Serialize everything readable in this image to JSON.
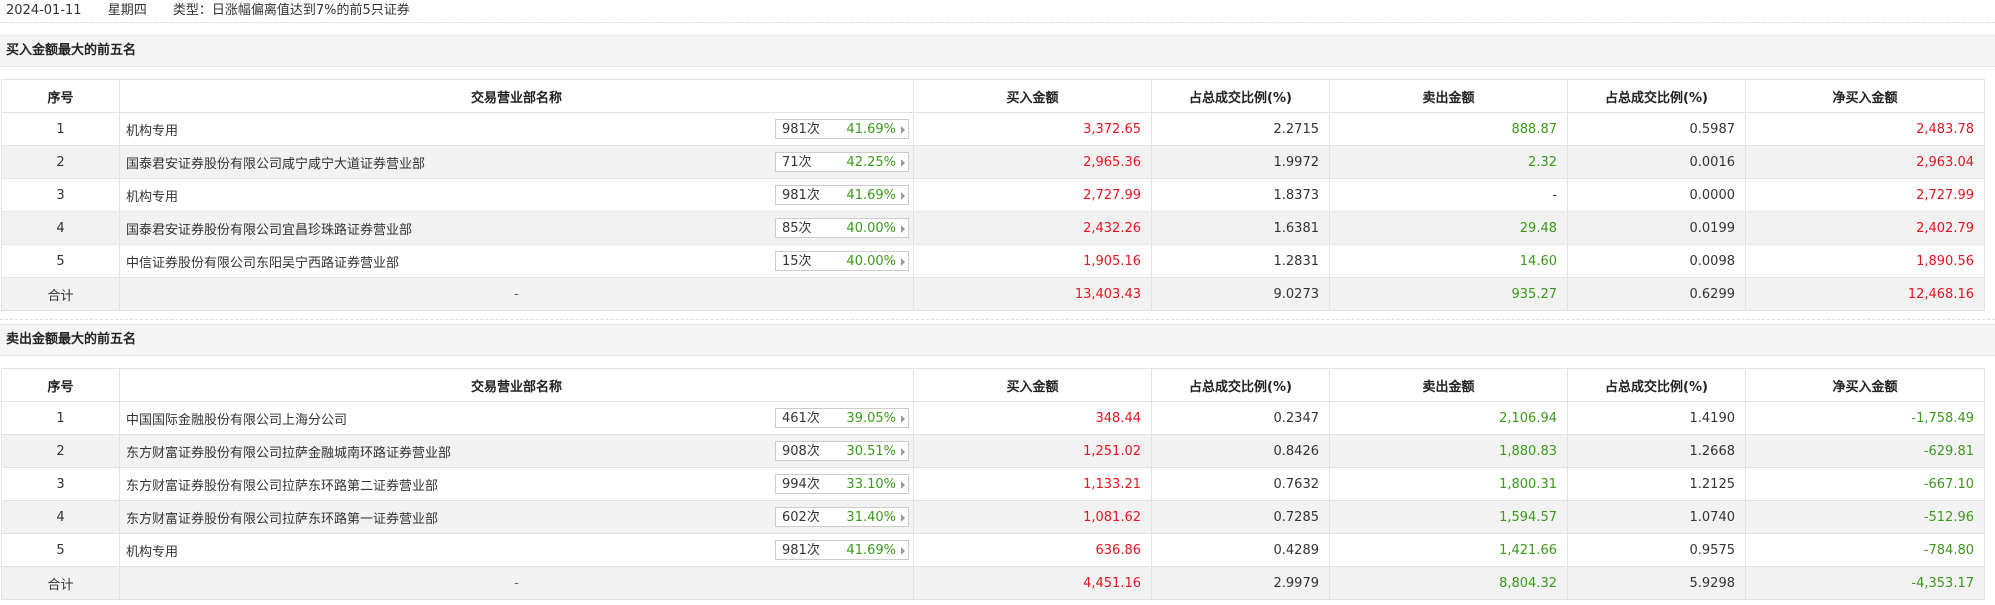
{
  "header": {
    "date": "2024-01-11",
    "weekday": "星期四",
    "type_text": "类型：日涨幅偏离值达到7%的前5只证券"
  },
  "columns": [
    "序号",
    "交易营业部名称",
    "买入金额",
    "占总成交比例(%)",
    "卖出金额",
    "占总成交比例(%)",
    "净买入金额"
  ],
  "colors": {
    "positive": "#e8141f",
    "negative": "#3a9a19",
    "badge_pct": "#3a9a19"
  },
  "buy_section": {
    "title": "买入金额最大的前五名",
    "rows": [
      {
        "idx": "1",
        "name": "机构专用",
        "count": "981次",
        "pct": "41.69%",
        "buy": "3,372.65",
        "buy_ratio": "2.2715",
        "sell": "888.87",
        "sell_ratio": "0.5987",
        "net": "2,483.78"
      },
      {
        "idx": "2",
        "name": "国泰君安证券股份有限公司咸宁咸宁大道证券营业部",
        "count": "71次",
        "pct": "42.25%",
        "buy": "2,965.36",
        "buy_ratio": "1.9972",
        "sell": "2.32",
        "sell_ratio": "0.0016",
        "net": "2,963.04"
      },
      {
        "idx": "3",
        "name": "机构专用",
        "count": "981次",
        "pct": "41.69%",
        "buy": "2,727.99",
        "buy_ratio": "1.8373",
        "sell": "-",
        "sell_ratio": "0.0000",
        "net": "2,727.99"
      },
      {
        "idx": "4",
        "name": "国泰君安证券股份有限公司宜昌珍珠路证券营业部",
        "count": "85次",
        "pct": "40.00%",
        "buy": "2,432.26",
        "buy_ratio": "1.6381",
        "sell": "29.48",
        "sell_ratio": "0.0199",
        "net": "2,402.79"
      },
      {
        "idx": "5",
        "name": "中信证券股份有限公司东阳吴宁西路证券营业部",
        "count": "15次",
        "pct": "40.00%",
        "buy": "1,905.16",
        "buy_ratio": "1.2831",
        "sell": "14.60",
        "sell_ratio": "0.0098",
        "net": "1,890.56"
      }
    ],
    "total": {
      "label": "合计",
      "name": "-",
      "buy": "13,403.43",
      "buy_ratio": "9.0273",
      "sell": "935.27",
      "sell_ratio": "0.6299",
      "net": "12,468.16"
    }
  },
  "sell_section": {
    "title": "卖出金额最大的前五名",
    "rows": [
      {
        "idx": "1",
        "name": "中国国际金融股份有限公司上海分公司",
        "count": "461次",
        "pct": "39.05%",
        "buy": "348.44",
        "buy_ratio": "0.2347",
        "sell": "2,106.94",
        "sell_ratio": "1.4190",
        "net": "-1,758.49"
      },
      {
        "idx": "2",
        "name": "东方财富证券股份有限公司拉萨金融城南环路证券营业部",
        "count": "908次",
        "pct": "30.51%",
        "buy": "1,251.02",
        "buy_ratio": "0.8426",
        "sell": "1,880.83",
        "sell_ratio": "1.2668",
        "net": "-629.81"
      },
      {
        "idx": "3",
        "name": "东方财富证券股份有限公司拉萨东环路第二证券营业部",
        "count": "994次",
        "pct": "33.10%",
        "buy": "1,133.21",
        "buy_ratio": "0.7632",
        "sell": "1,800.31",
        "sell_ratio": "1.2125",
        "net": "-667.10"
      },
      {
        "idx": "4",
        "name": "东方财富证券股份有限公司拉萨东环路第一证券营业部",
        "count": "602次",
        "pct": "31.40%",
        "buy": "1,081.62",
        "buy_ratio": "0.7285",
        "sell": "1,594.57",
        "sell_ratio": "1.0740",
        "net": "-512.96"
      },
      {
        "idx": "5",
        "name": "机构专用",
        "count": "981次",
        "pct": "41.69%",
        "buy": "636.86",
        "buy_ratio": "0.4289",
        "sell": "1,421.66",
        "sell_ratio": "0.9575",
        "net": "-784.80"
      }
    ],
    "total": {
      "label": "合计",
      "name": "-",
      "buy": "4,451.16",
      "buy_ratio": "2.9979",
      "sell": "8,804.32",
      "sell_ratio": "5.9298",
      "net": "-4,353.17"
    }
  }
}
